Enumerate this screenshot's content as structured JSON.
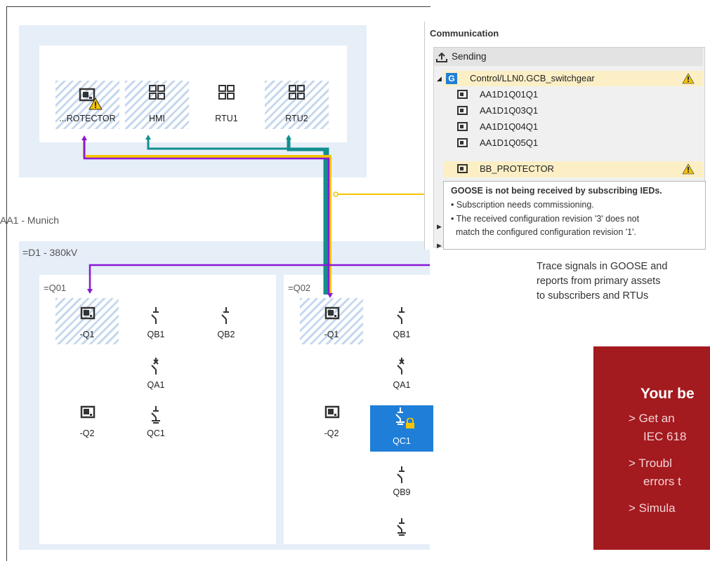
{
  "diagram": {
    "ieds_top": [
      {
        "label": "...ROTECTOR",
        "icon": "ied-monitor-icon",
        "warning": true
      },
      {
        "label": "HMI",
        "icon": "network-grid-icon"
      },
      {
        "label": "RTU1",
        "icon": "network-grid-icon"
      },
      {
        "label": "RTU2",
        "icon": "network-grid-icon"
      }
    ],
    "site_label": "AA1 - Munich",
    "voltage_level": "=D1 - 380kV",
    "bays": [
      {
        "label": "=Q01",
        "devices": [
          {
            "label": "-Q1",
            "icon": "ied-monitor-icon"
          },
          {
            "label": "QB1",
            "icon": "disconnector-icon"
          },
          {
            "label": "QB2",
            "icon": "disconnector-icon"
          },
          {
            "label": "QA1",
            "icon": "circuit-breaker-icon"
          },
          {
            "label": "-Q2",
            "icon": "ied-monitor-icon"
          },
          {
            "label": "QC1",
            "icon": "earthing-switch-icon"
          }
        ]
      },
      {
        "label": "=Q02",
        "devices": [
          {
            "label": "-Q1",
            "icon": "ied-monitor-icon"
          },
          {
            "label": "QB1",
            "icon": "disconnector-icon"
          },
          {
            "label": "QA1",
            "icon": "circuit-breaker-icon"
          },
          {
            "label": "-Q2",
            "icon": "ied-monitor-icon"
          },
          {
            "label": "QC1",
            "icon": "earthing-switch-icon",
            "selected": true,
            "locked": true
          },
          {
            "label": "QB9",
            "icon": "disconnector-icon"
          }
        ]
      }
    ],
    "colors": {
      "yellow": "#f5c400",
      "purple": "#8a17d6",
      "teal": "#138f8f",
      "selected": "#1f7fd8"
    }
  },
  "communication": {
    "title": "Communication",
    "sending_label": "Sending",
    "gcb_badge": "G",
    "gcb": "Control/LLN0.GCB_switchgear",
    "subscribers": [
      "AA1D1Q01Q1",
      "AA1D1Q03Q1",
      "AA1D1Q04Q1",
      "AA1D1Q05Q1",
      "BB_PROTECTOR"
    ],
    "tooltip": {
      "title": "GOOSE is not being received by subscribing IEDs.",
      "lines": [
        "• Subscription needs commissioning.",
        "• The received configuration revision '3' does not",
        "  match the configured configuration revision '1'."
      ]
    }
  },
  "caption": [
    "Trace signals in GOOSE and",
    "reports from primary assets",
    "to subscribers and RTUs"
  ],
  "promo": {
    "title": "Your be",
    "items": [
      "> Get an",
      "IEC 618",
      "> Troubl",
      "errors t",
      "> Simula"
    ]
  }
}
